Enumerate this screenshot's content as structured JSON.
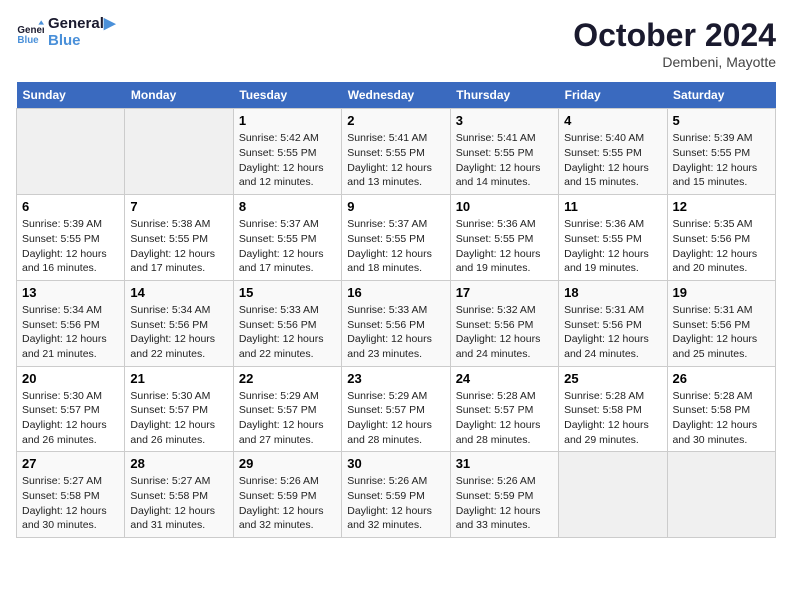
{
  "header": {
    "logo_line1": "General",
    "logo_line2": "Blue",
    "main_title": "October 2024",
    "subtitle": "Dembeni, Mayotte"
  },
  "days_of_week": [
    "Sunday",
    "Monday",
    "Tuesday",
    "Wednesday",
    "Thursday",
    "Friday",
    "Saturday"
  ],
  "weeks": [
    [
      {
        "day": "",
        "empty": true
      },
      {
        "day": "",
        "empty": true
      },
      {
        "day": "1",
        "sunrise": "5:42 AM",
        "sunset": "5:55 PM",
        "daylight": "12 hours and 12 minutes."
      },
      {
        "day": "2",
        "sunrise": "5:41 AM",
        "sunset": "5:55 PM",
        "daylight": "12 hours and 13 minutes."
      },
      {
        "day": "3",
        "sunrise": "5:41 AM",
        "sunset": "5:55 PM",
        "daylight": "12 hours and 14 minutes."
      },
      {
        "day": "4",
        "sunrise": "5:40 AM",
        "sunset": "5:55 PM",
        "daylight": "12 hours and 15 minutes."
      },
      {
        "day": "5",
        "sunrise": "5:39 AM",
        "sunset": "5:55 PM",
        "daylight": "12 hours and 15 minutes."
      }
    ],
    [
      {
        "day": "6",
        "sunrise": "5:39 AM",
        "sunset": "5:55 PM",
        "daylight": "12 hours and 16 minutes."
      },
      {
        "day": "7",
        "sunrise": "5:38 AM",
        "sunset": "5:55 PM",
        "daylight": "12 hours and 17 minutes."
      },
      {
        "day": "8",
        "sunrise": "5:37 AM",
        "sunset": "5:55 PM",
        "daylight": "12 hours and 17 minutes."
      },
      {
        "day": "9",
        "sunrise": "5:37 AM",
        "sunset": "5:55 PM",
        "daylight": "12 hours and 18 minutes."
      },
      {
        "day": "10",
        "sunrise": "5:36 AM",
        "sunset": "5:55 PM",
        "daylight": "12 hours and 19 minutes."
      },
      {
        "day": "11",
        "sunrise": "5:36 AM",
        "sunset": "5:55 PM",
        "daylight": "12 hours and 19 minutes."
      },
      {
        "day": "12",
        "sunrise": "5:35 AM",
        "sunset": "5:56 PM",
        "daylight": "12 hours and 20 minutes."
      }
    ],
    [
      {
        "day": "13",
        "sunrise": "5:34 AM",
        "sunset": "5:56 PM",
        "daylight": "12 hours and 21 minutes."
      },
      {
        "day": "14",
        "sunrise": "5:34 AM",
        "sunset": "5:56 PM",
        "daylight": "12 hours and 22 minutes."
      },
      {
        "day": "15",
        "sunrise": "5:33 AM",
        "sunset": "5:56 PM",
        "daylight": "12 hours and 22 minutes."
      },
      {
        "day": "16",
        "sunrise": "5:33 AM",
        "sunset": "5:56 PM",
        "daylight": "12 hours and 23 minutes."
      },
      {
        "day": "17",
        "sunrise": "5:32 AM",
        "sunset": "5:56 PM",
        "daylight": "12 hours and 24 minutes."
      },
      {
        "day": "18",
        "sunrise": "5:31 AM",
        "sunset": "5:56 PM",
        "daylight": "12 hours and 24 minutes."
      },
      {
        "day": "19",
        "sunrise": "5:31 AM",
        "sunset": "5:56 PM",
        "daylight": "12 hours and 25 minutes."
      }
    ],
    [
      {
        "day": "20",
        "sunrise": "5:30 AM",
        "sunset": "5:57 PM",
        "daylight": "12 hours and 26 minutes."
      },
      {
        "day": "21",
        "sunrise": "5:30 AM",
        "sunset": "5:57 PM",
        "daylight": "12 hours and 26 minutes."
      },
      {
        "day": "22",
        "sunrise": "5:29 AM",
        "sunset": "5:57 PM",
        "daylight": "12 hours and 27 minutes."
      },
      {
        "day": "23",
        "sunrise": "5:29 AM",
        "sunset": "5:57 PM",
        "daylight": "12 hours and 28 minutes."
      },
      {
        "day": "24",
        "sunrise": "5:28 AM",
        "sunset": "5:57 PM",
        "daylight": "12 hours and 28 minutes."
      },
      {
        "day": "25",
        "sunrise": "5:28 AM",
        "sunset": "5:58 PM",
        "daylight": "12 hours and 29 minutes."
      },
      {
        "day": "26",
        "sunrise": "5:28 AM",
        "sunset": "5:58 PM",
        "daylight": "12 hours and 30 minutes."
      }
    ],
    [
      {
        "day": "27",
        "sunrise": "5:27 AM",
        "sunset": "5:58 PM",
        "daylight": "12 hours and 30 minutes."
      },
      {
        "day": "28",
        "sunrise": "5:27 AM",
        "sunset": "5:58 PM",
        "daylight": "12 hours and 31 minutes."
      },
      {
        "day": "29",
        "sunrise": "5:26 AM",
        "sunset": "5:59 PM",
        "daylight": "12 hours and 32 minutes."
      },
      {
        "day": "30",
        "sunrise": "5:26 AM",
        "sunset": "5:59 PM",
        "daylight": "12 hours and 32 minutes."
      },
      {
        "day": "31",
        "sunrise": "5:26 AM",
        "sunset": "5:59 PM",
        "daylight": "12 hours and 33 minutes."
      },
      {
        "day": "",
        "empty": true
      },
      {
        "day": "",
        "empty": true
      }
    ]
  ],
  "labels": {
    "sunrise_label": "Sunrise:",
    "sunset_label": "Sunset:",
    "daylight_label": "Daylight:"
  }
}
